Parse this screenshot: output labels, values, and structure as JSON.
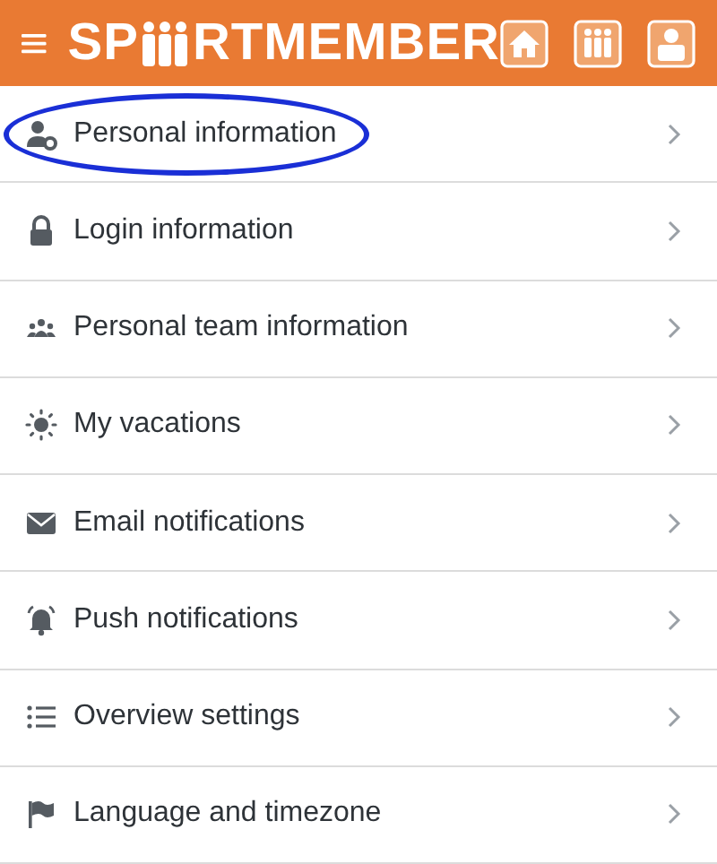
{
  "header": {
    "logo": [
      "SP",
      "RTMEMBER"
    ]
  },
  "menu": [
    {
      "label": "Personal information",
      "circled": true
    },
    {
      "label": "Login information",
      "circled": false
    },
    {
      "label": "Personal team information",
      "circled": false
    },
    {
      "label": "My vacations",
      "circled": false
    },
    {
      "label": "Email notifications",
      "circled": false
    },
    {
      "label": "Push notifications",
      "circled": false
    },
    {
      "label": "Overview settings",
      "circled": false
    },
    {
      "label": "Language and timezone",
      "circled": false
    }
  ]
}
